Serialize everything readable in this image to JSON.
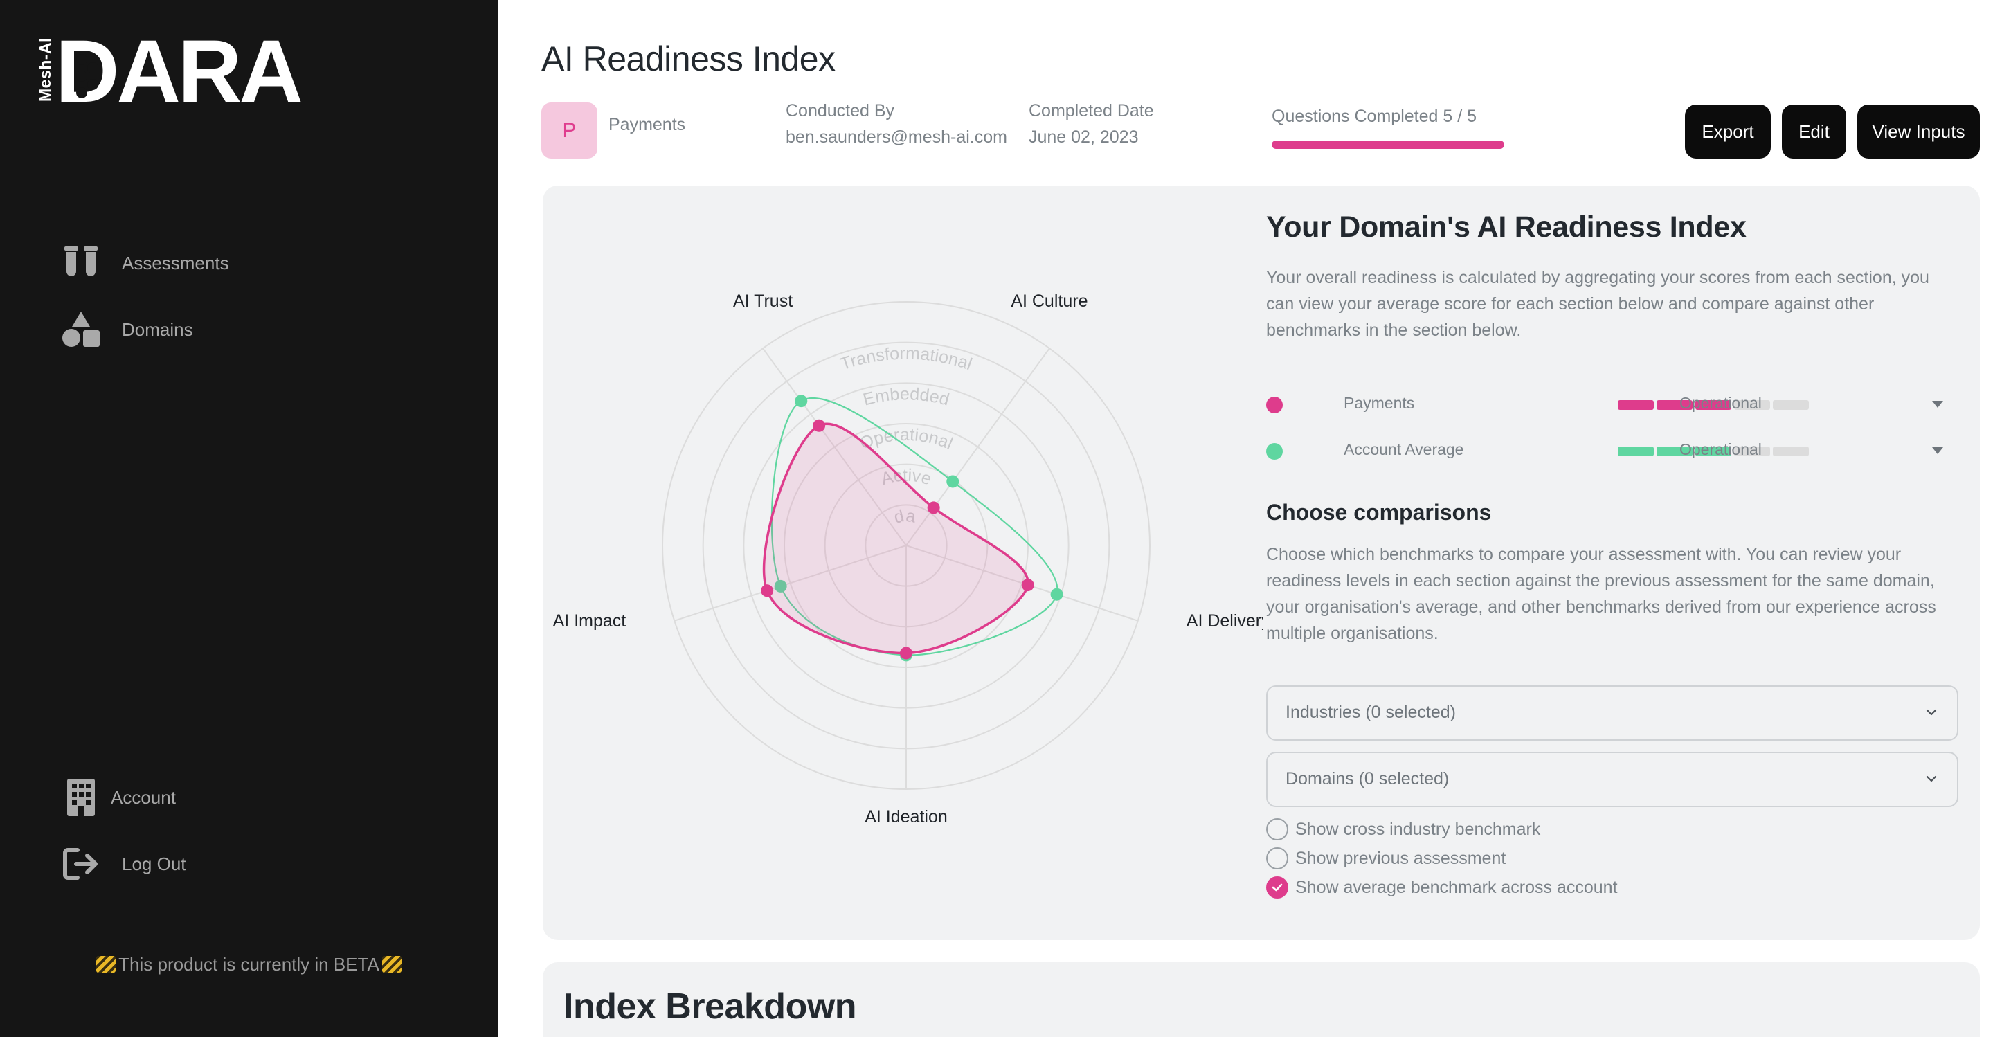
{
  "sidebar": {
    "logo": {
      "vertical_text": "Mesh-AI",
      "word": "DARA"
    },
    "nav": [
      {
        "label": "Assessments",
        "icon": "test-tubes-icon"
      },
      {
        "label": "Domains",
        "icon": "shapes-icon"
      }
    ],
    "bottom_nav": [
      {
        "label": "Account",
        "icon": "building-icon"
      },
      {
        "label": "Log Out",
        "icon": "logout-icon"
      }
    ],
    "beta_notice": "This product is currently in BETA"
  },
  "header": {
    "title": "AI Readiness Index",
    "domain_initial": "P",
    "domain_name": "Payments",
    "conducted_by_label": "Conducted By",
    "conducted_by_value": "ben.saunders@mesh-ai.com",
    "completed_date_label": "Completed Date",
    "completed_date_value": "June 02, 2023",
    "progress_label": "Questions Completed 5 / 5",
    "progress_fraction": 1.0,
    "buttons": {
      "export": "Export",
      "edit": "Edit",
      "view_inputs": "View Inputs"
    }
  },
  "chart_data": {
    "type": "radar",
    "axes": [
      "AI Culture",
      "AI Delivery",
      "AI Ideation",
      "AI Impact",
      "AI Trust"
    ],
    "levels": [
      "Foundational",
      "Active",
      "Operational",
      "Embedded",
      "Transformational"
    ],
    "max": 6,
    "series": [
      {
        "name": "Payments",
        "color": "#de3c8c",
        "values": [
          1.15,
          3.15,
          2.65,
          3.6,
          3.65
        ]
      },
      {
        "name": "Account Average",
        "color": "#5fd6a0",
        "values": [
          1.95,
          3.9,
          2.7,
          3.25,
          4.4
        ]
      }
    ]
  },
  "right_panel": {
    "title": "Your Domain's AI Readiness Index",
    "description": "Your overall readiness is calculated by aggregating your scores from each section, you can view your average score for each section below and compare against other benchmarks in the section below.",
    "legend": [
      {
        "name": "Payments",
        "color": "#de3c8c",
        "level": "Operational",
        "filled": 3,
        "segments": 5
      },
      {
        "name": "Account Average",
        "color": "#5fd6a0",
        "level": "Operational",
        "filled": 3,
        "segments": 5
      }
    ],
    "comparisons_title": "Choose comparisons",
    "comparisons_description": "Choose which benchmarks to compare your assessment with. You can review your readiness levels in each section against the previous assessment for the same domain, your organisation's average, and other benchmarks derived from our experience across multiple organisations.",
    "selects": {
      "industries": "Industries (0 selected)",
      "domains": "Domains (0 selected)"
    },
    "options": [
      {
        "label": "Show cross industry benchmark",
        "checked": false
      },
      {
        "label": "Show previous assessment",
        "checked": false
      },
      {
        "label": "Show average benchmark across account",
        "checked": true
      }
    ]
  },
  "breakdown": {
    "title": "Index Breakdown"
  }
}
